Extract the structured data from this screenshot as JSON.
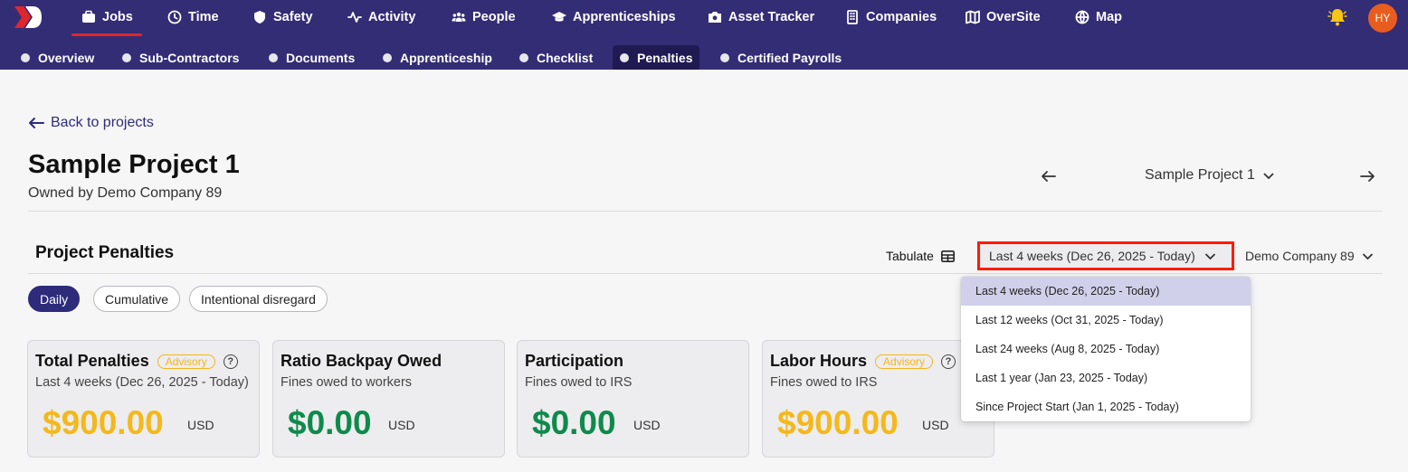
{
  "nav": {
    "items": [
      {
        "label": "Jobs",
        "icon": "briefcase-icon"
      },
      {
        "label": "Time",
        "icon": "clock-icon"
      },
      {
        "label": "Safety",
        "icon": "shield-icon"
      },
      {
        "label": "Activity",
        "icon": "activity-icon"
      },
      {
        "label": "People",
        "icon": "people-icon"
      },
      {
        "label": "Apprenticeships",
        "icon": "graduation-cap-icon"
      },
      {
        "label": "Asset Tracker",
        "icon": "camera-icon"
      },
      {
        "label": "Companies",
        "icon": "building-icon"
      },
      {
        "label": "OverSite",
        "icon": "map-icon"
      },
      {
        "label": "Map",
        "icon": "globe-icon"
      }
    ],
    "active": "Jobs",
    "avatar_initials": "HY"
  },
  "subnav": {
    "items": [
      {
        "label": "Overview"
      },
      {
        "label": "Sub-Contractors"
      },
      {
        "label": "Documents"
      },
      {
        "label": "Apprenticeship"
      },
      {
        "label": "Checklist"
      },
      {
        "label": "Penalties"
      },
      {
        "label": "Certified Payrolls"
      }
    ],
    "active": "Penalties"
  },
  "page": {
    "back_label": "Back to projects",
    "title": "Sample Project 1",
    "owner": "Owned by Demo Company 89",
    "project_selector": "Sample Project 1"
  },
  "penalties": {
    "title": "Project Penalties",
    "tabulate_label": "Tabulate",
    "date_range": "Last 4 weeks (Dec 26, 2025 - Today)",
    "company": "Demo Company 89",
    "pills": [
      {
        "label": "Daily"
      },
      {
        "label": "Cumulative"
      },
      {
        "label": "Intentional disregard"
      }
    ],
    "active_pill": "Daily",
    "cards": [
      {
        "title": "Total Penalties",
        "badge": "Advisory",
        "help": "?",
        "subtitle": "Last 4 weeks (Dec 26, 2025 - Today)",
        "value": "$900.00",
        "currency": "USD",
        "color": "#f5b81c"
      },
      {
        "title": "Ratio Backpay Owed",
        "subtitle": "Fines owed to workers",
        "value": "$0.00",
        "currency": "USD",
        "color": "#0f8a4c"
      },
      {
        "title": "Participation",
        "subtitle": "Fines owed to IRS",
        "value": "$0.00",
        "currency": "USD",
        "color": "#0f8a4c"
      },
      {
        "title": "Labor Hours",
        "badge": "Advisory",
        "help": "?",
        "subtitle": "Fines owed to IRS",
        "value": "$900.00",
        "currency": "USD",
        "color": "#f5b81c"
      }
    ]
  },
  "dropdown": {
    "options": [
      "Last 4 weeks (Dec 26, 2025 - Today)",
      "Last 12 weeks (Oct 31, 2025 - Today)",
      "Last 24 weeks (Aug 8, 2025 - Today)",
      "Last 1 year (Jan 23, 2025 - Today)",
      "Since Project Start (Jan 1, 2025 - Today)"
    ],
    "selected": "Last 4 weeks (Dec 26, 2025 - Today)"
  },
  "colors": {
    "nav_bg": "#332d75",
    "accent": "#2d2b7a",
    "active_underline": "#e0262b",
    "highlight_border": "#ff1a00",
    "advisory": "#f2b51c"
  }
}
